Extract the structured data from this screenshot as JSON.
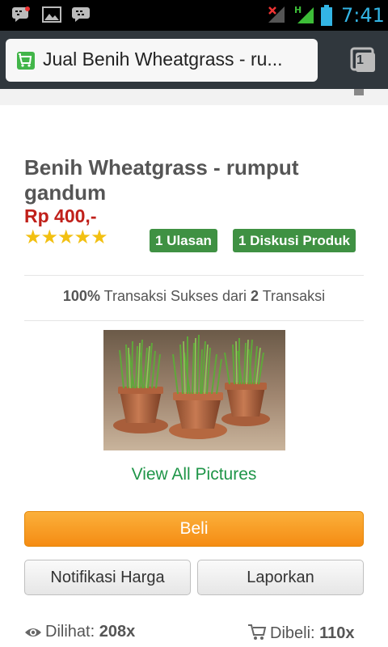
{
  "status_bar": {
    "time": "7:41",
    "icons": [
      "bbm-notification-icon",
      "picture-icon",
      "bbm-icon",
      "no-signal-icon",
      "h-signal-icon",
      "battery-icon"
    ]
  },
  "browser": {
    "url_title": "Jual Benih Wheatgrass - ru...",
    "tab_count": "1",
    "favicon": "tokopedia-favicon"
  },
  "product": {
    "title": "Benih Wheatgrass - rumput gandum",
    "price": "Rp 400,-",
    "rating": 5,
    "rating_stars": "★★★★★",
    "reviews_badge": "1 Ulasan",
    "discussion_badge": "1 Diskusi Produk"
  },
  "transactions": {
    "success_percent": "100%",
    "text_mid": " Transaksi Sukses dari ",
    "total": "2",
    "text_end": " Transaksi"
  },
  "gallery": {
    "view_all_label": "View All Pictures"
  },
  "actions": {
    "buy_label": "Beli",
    "price_notification_label": "Notifikasi Harga",
    "report_label": "Laporkan"
  },
  "stats": {
    "views_label": "Dilihat:",
    "views_value": "208x",
    "bought_label": "Dibeli:",
    "bought_value": "110x"
  },
  "colors": {
    "accent_green": "#3f9143",
    "price_red": "#c0201a",
    "buy_orange": "#f58c13",
    "star_yellow": "#f2c012",
    "link_green": "#1f9548"
  }
}
